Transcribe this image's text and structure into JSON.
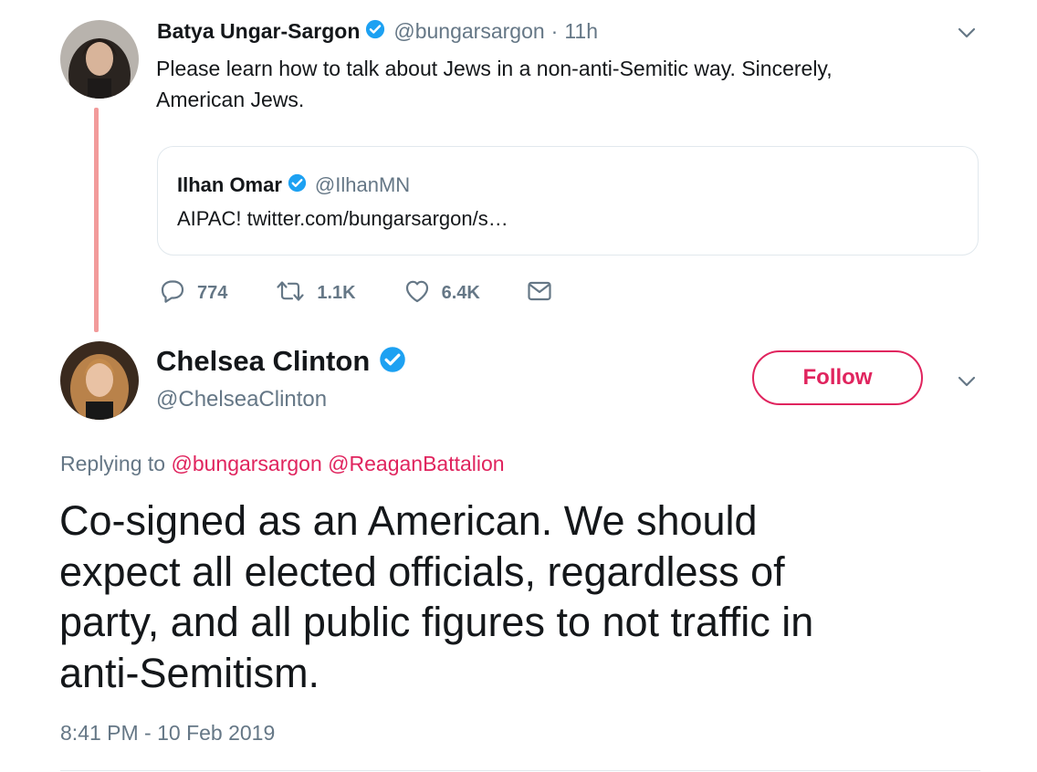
{
  "parent_tweet": {
    "author_name": "Batya Ungar-Sargon",
    "handle": "@bungarsargon",
    "separator": "·",
    "time": "11h",
    "text_line1": "Please learn how to talk about Jews in a non-anti-Semitic way. Sincerely,",
    "text_line2": "American Jews.",
    "quoted": {
      "author_name": "Ilhan Omar",
      "handle": "@IlhanMN",
      "text": "AIPAC! twitter.com/bungarsargon/s…"
    },
    "actions": {
      "reply_count": "774",
      "retweet_count": "1.1K",
      "like_count": "6.4K"
    }
  },
  "main_tweet": {
    "author_name": "Chelsea Clinton",
    "handle": "@ChelseaClinton",
    "follow_label": "Follow",
    "replying_label": "Replying to",
    "mention1": "@bungarsargon",
    "mention2": "@ReaganBattalion",
    "text_line1": "Co-signed as an American. We should",
    "text_line2": "expect all elected officials, regardless of",
    "text_line3": "party, and all public figures to not traffic in",
    "text_line4": "anti-Semitism.",
    "timestamp": "8:41 PM - 10 Feb 2019"
  },
  "colors": {
    "accent": "#e0245e",
    "verified": "#1da1f2",
    "secondary_text": "#657786",
    "thread_line": "#f29b9b",
    "border": "#e1e8ed"
  },
  "icons": [
    "chevron-down-icon",
    "verified-badge-icon",
    "reply-icon",
    "retweet-icon",
    "like-icon",
    "message-icon"
  ]
}
